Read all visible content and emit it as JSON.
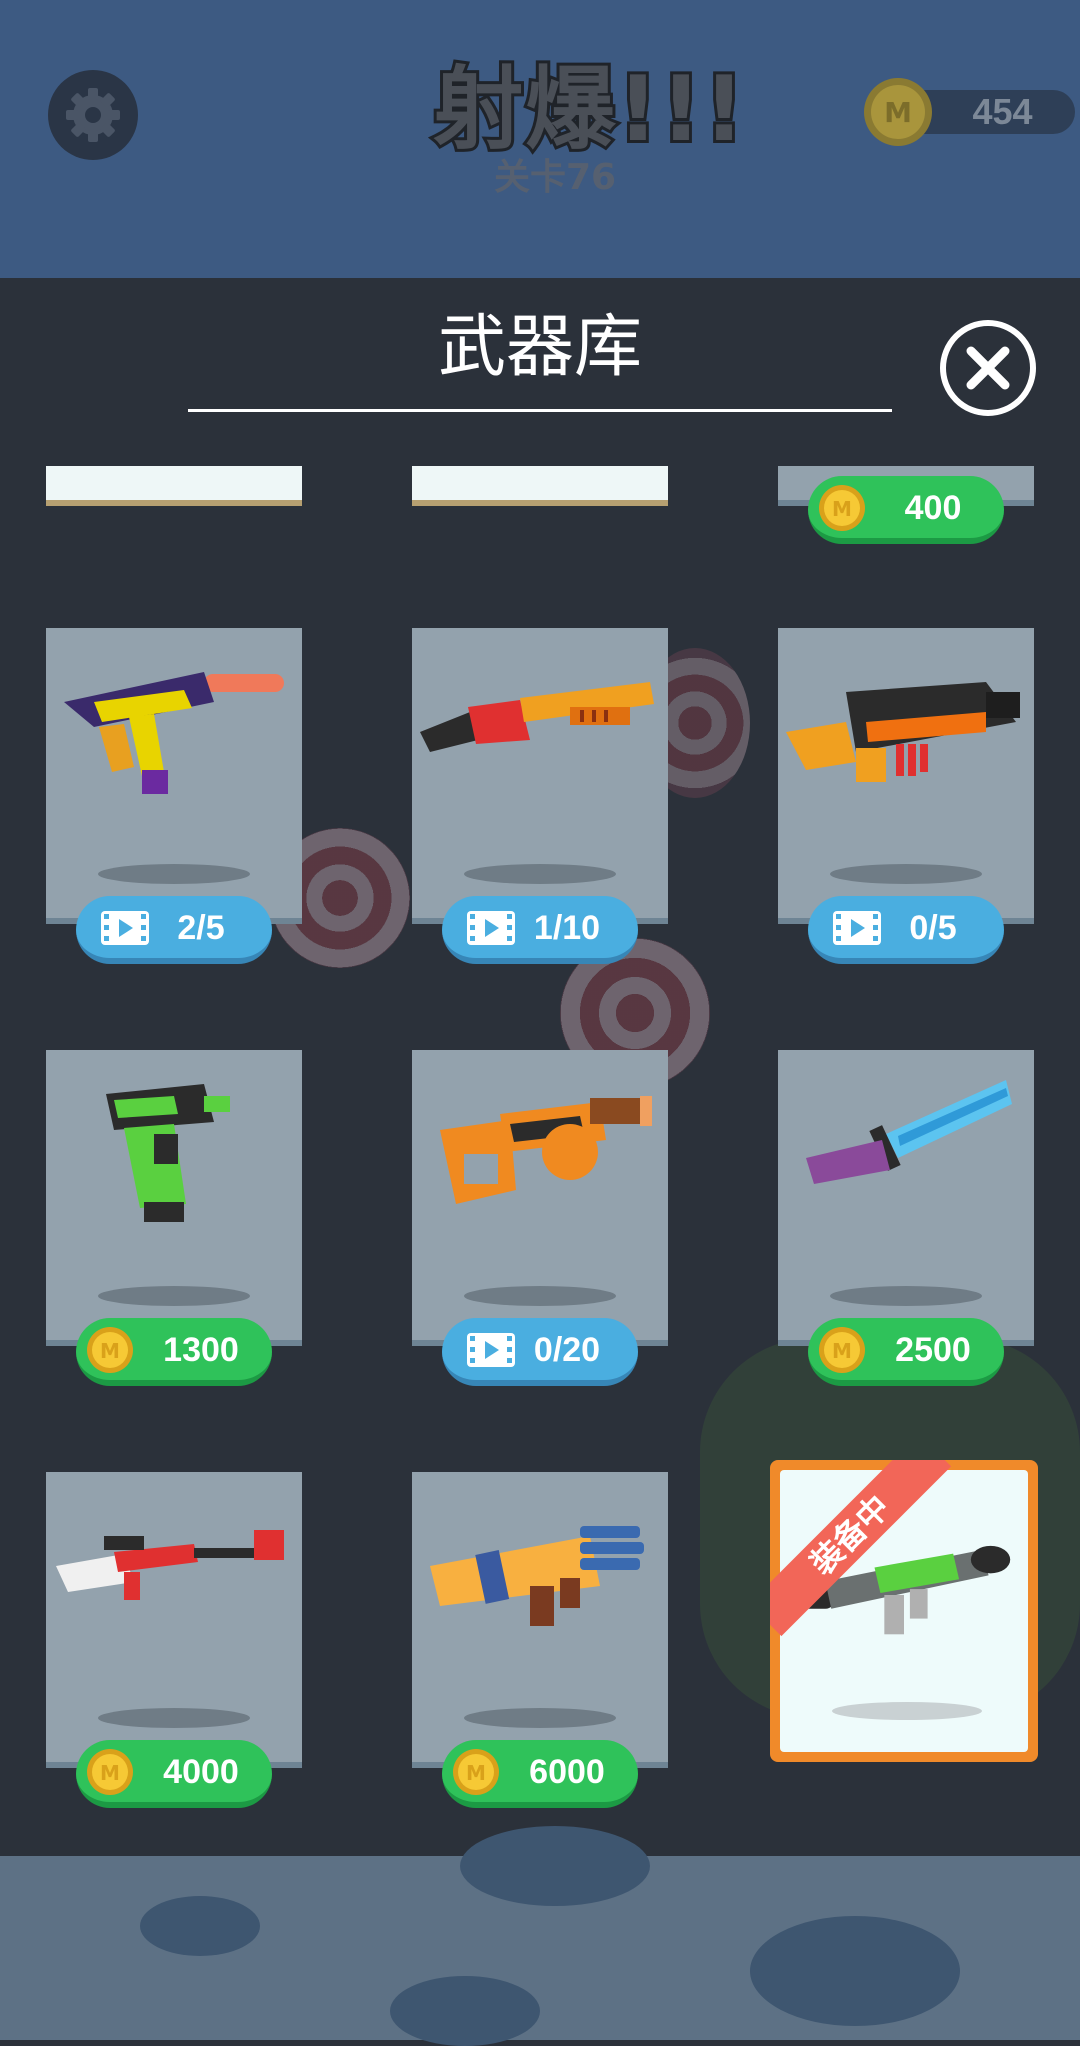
{
  "hud": {
    "title": "射爆!!!",
    "level": "关卡76",
    "coins": "454",
    "settings_icon": "gear-icon",
    "coin_icon": "coin-icon"
  },
  "panel": {
    "title": "武器库",
    "close_icon": "close-icon"
  },
  "top_row_partial": [
    {
      "price": null
    },
    {
      "price": null
    },
    {
      "price": "400",
      "price_type": "coin"
    }
  ],
  "weapons": [
    {
      "name_icon": "smg-purple-yellow-icon",
      "price": "2/5",
      "price_type": "video"
    },
    {
      "name_icon": "shotgun-red-orange-icon",
      "price": "1/10",
      "price_type": "video"
    },
    {
      "name_icon": "rifle-black-orange-icon",
      "price": "0/5",
      "price_type": "video"
    },
    {
      "name_icon": "pistol-green-black-icon",
      "price": "1300",
      "price_type": "coin"
    },
    {
      "name_icon": "blaster-orange-icon",
      "price": "0/20",
      "price_type": "video"
    },
    {
      "name_icon": "knife-blue-icon",
      "price": "2500",
      "price_type": "coin"
    },
    {
      "name_icon": "sniper-red-white-icon",
      "price": "4000",
      "price_type": "coin"
    },
    {
      "name_icon": "gatling-yellow-blue-icon",
      "price": "6000",
      "price_type": "coin"
    },
    {
      "name_icon": "rocket-launcher-green-icon",
      "status": "装备中",
      "equipped": true
    }
  ],
  "colors": {
    "coin_pill": "#2fc25a",
    "video_pill": "#4aaee0",
    "equipped_border": "#f08a2a",
    "ribbon": "#f26658"
  }
}
